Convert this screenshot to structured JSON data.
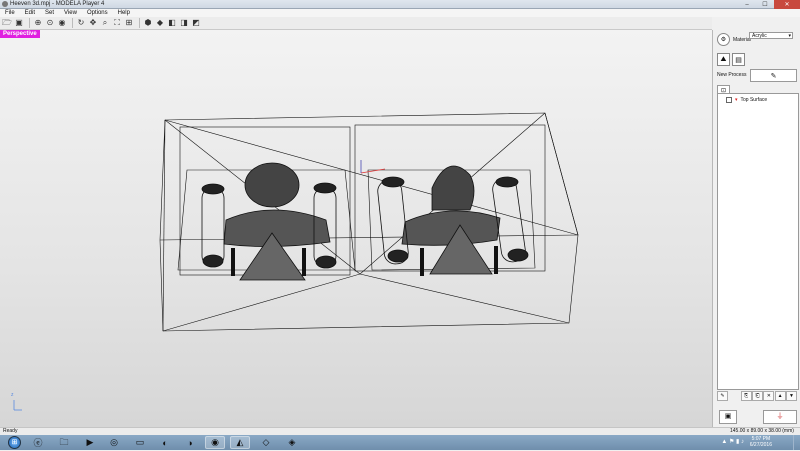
{
  "window": {
    "title": "Heeven 3d.mpj - MODELA Player 4",
    "minimize": "–",
    "maximize": "☐",
    "close": "✕"
  },
  "menu": [
    "File",
    "Edit",
    "Set",
    "View",
    "Options",
    "Help"
  ],
  "toolbar": {
    "icons": [
      "open-icon",
      "save-icon",
      "sep",
      "fit-icon",
      "zoom-in-icon",
      "zoom-out-icon",
      "sep",
      "rotate-icon",
      "pan-icon",
      "zoom-icon",
      "zoom-window-icon",
      "fit-all-icon",
      "sep",
      "view-iso-icon",
      "view-front-icon",
      "view-side-icon",
      "view-top-icon",
      "view-other-icon"
    ]
  },
  "viewport": {
    "label": "Perspective",
    "axis_label": "z",
    "colors": {
      "label_bg": "#e020e0",
      "wire": "#111111"
    }
  },
  "right_panel": {
    "material_label": "Material",
    "material_value": "Acrylic",
    "new_process_label": "New Process",
    "tree_items": [
      {
        "label": "Top Surface"
      }
    ]
  },
  "status": {
    "ready": "Ready",
    "dimensions": "145.00 x 89.00 x 38.00 (mm)"
  },
  "taskbar": {
    "apps": [
      "ie-icon",
      "explorer-icon",
      "media-icon",
      "app-icon",
      "folder-icon",
      "firefox-icon",
      "firefox-icon",
      "chrome-icon",
      "modela-icon",
      "app-icon",
      "app-icon"
    ],
    "time": "5:07 PM",
    "date": "6/27/2016"
  }
}
